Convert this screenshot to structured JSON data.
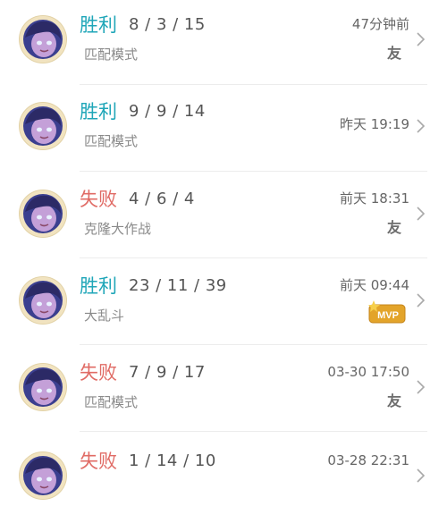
{
  "matches": [
    {
      "result": "胜利",
      "kda": "8 / 3 / 15",
      "mode": "匹配模式",
      "time": "47分钟前",
      "badge": "friend",
      "badge_text": "友"
    },
    {
      "result": "胜利",
      "kda": "9 / 9 / 14",
      "mode": "匹配模式",
      "time": "昨天 19:19",
      "badge": "none",
      "badge_text": ""
    },
    {
      "result": "失败",
      "kda": "4 / 6 / 4",
      "mode": "克隆大作战",
      "time": "前天 18:31",
      "badge": "friend",
      "badge_text": "友"
    },
    {
      "result": "胜利",
      "kda": "23 / 11 / 39",
      "mode": "大乱斗",
      "time": "前天 09:44",
      "badge": "mvp",
      "badge_text": "MVP"
    },
    {
      "result": "失败",
      "kda": "7 / 9 / 17",
      "mode": "匹配模式",
      "time": "03-30 17:50",
      "badge": "friend",
      "badge_text": "友"
    },
    {
      "result": "失败",
      "kda": "1 / 14 / 10",
      "mode": "",
      "time": "03-28 22:31",
      "badge": "none",
      "badge_text": ""
    }
  ],
  "colors": {
    "win": "#1fa6b8",
    "loss": "#e06b65",
    "mvp": "#e3a42a"
  },
  "icons": {
    "avatar": "hero-avatar",
    "row_arrow": "chevron-right-icon",
    "mvp_badge": "mvp-badge-icon"
  }
}
